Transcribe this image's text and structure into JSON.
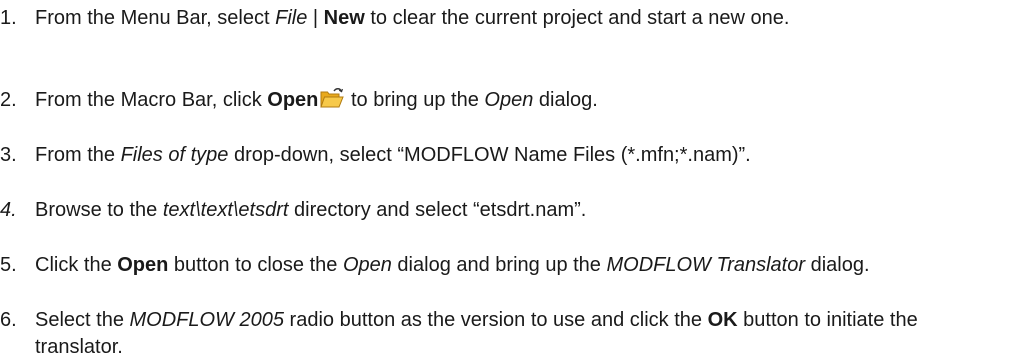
{
  "steps": [
    {
      "num": "1.",
      "parts": {
        "a": "From the Menu Bar, select ",
        "b": "File",
        "c": " | ",
        "d": "New",
        "e": " to clear the current project and start a new one."
      }
    },
    {
      "num": "2.",
      "parts": {
        "a": "From the Macro Bar, click ",
        "b": "Open",
        "c": " to bring up the ",
        "d": "Open",
        "e": " dialog."
      },
      "icon": "open-folder-icon"
    },
    {
      "num": "3.",
      "parts": {
        "a": "From the ",
        "b": "Files of type",
        "c": " drop-down, select “MODFLOW Name Files (*.mfn;*.nam)”."
      }
    },
    {
      "num": "4.",
      "parts": {
        "a": "Browse to the ",
        "b": "text\\text\\etsdrt",
        "c": " directory and select “etsdrt.nam”."
      }
    },
    {
      "num": "5.",
      "parts": {
        "a": "Click the ",
        "b": "Open",
        "c": " button to close the ",
        "d": "Open",
        "e": " dialog and bring up the ",
        "f": "MODFLOW Translator",
        "g": " dialog."
      }
    },
    {
      "num": "6.",
      "parts": {
        "a": "Select the ",
        "b": "MODFLOW 2005",
        "c": " radio button as the version to use and click the ",
        "d": "OK",
        "e": " button to initiate the translator."
      }
    }
  ]
}
